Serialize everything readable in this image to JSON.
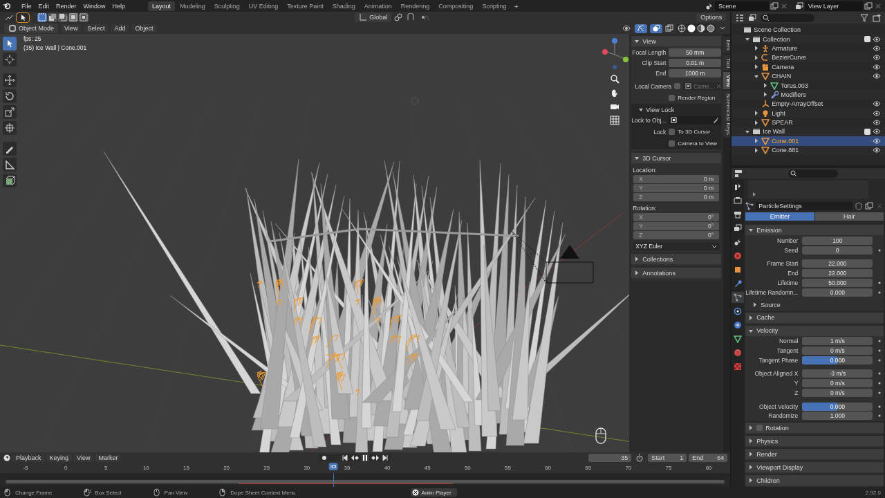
{
  "top_bar": {
    "menus": [
      "File",
      "Edit",
      "Render",
      "Window",
      "Help"
    ],
    "workspaces": [
      {
        "label": "Layout",
        "selected": true
      },
      {
        "label": "Modeling",
        "selected": false
      },
      {
        "label": "Sculpting",
        "selected": false
      },
      {
        "label": "UV Editing",
        "selected": false
      },
      {
        "label": "Texture Paint",
        "selected": false
      },
      {
        "label": "Shading",
        "selected": false
      },
      {
        "label": "Animation",
        "selected": false
      },
      {
        "label": "Rendering",
        "selected": false
      },
      {
        "label": "Compositing",
        "selected": false
      },
      {
        "label": "Scripting",
        "selected": false
      }
    ],
    "add_workspace": "+",
    "scene": "Scene",
    "view_layer": "View Layer"
  },
  "viewport": {
    "orientation": "Global",
    "options": "Options",
    "mode": "Object Mode",
    "menus": [
      "View",
      "Select",
      "Add",
      "Object"
    ],
    "overlay_text": [
      "fps: 25",
      "(35) Ice Wall | Cone.001"
    ],
    "tools": [
      {
        "kind": "select",
        "selected": true
      },
      {
        "kind": "cursor",
        "selected": false
      },
      {
        "kind": "move",
        "selected": false
      },
      {
        "kind": "rotate",
        "selected": false
      },
      {
        "kind": "scale",
        "selected": false
      },
      {
        "kind": "transform",
        "selected": false
      },
      {
        "kind": "annotate",
        "selected": false
      },
      {
        "kind": "measure",
        "selected": false
      },
      {
        "kind": "add",
        "selected": false
      }
    ]
  },
  "sidebar": {
    "tabs": [
      {
        "label": "Item",
        "selected": false
      },
      {
        "label": "Tool",
        "selected": false
      },
      {
        "label": "View",
        "selected": true
      },
      {
        "label": "Screencast Keys",
        "selected": false
      }
    ],
    "sections": [
      {
        "title": "View",
        "expanded": true,
        "rows": [
          {
            "kind": "field",
            "label": "Focal Length",
            "value": "50 mm"
          },
          {
            "kind": "field",
            "label": "Clip Start",
            "value": "0.01 m"
          },
          {
            "kind": "field",
            "label": "End",
            "value": "1000 m"
          },
          {
            "kind": "camera",
            "label": "Local Camera",
            "checked": false,
            "value": "Came..."
          },
          {
            "kind": "check",
            "label": "",
            "text": "Render Region",
            "checked": false
          },
          {
            "kind": "sub",
            "title": "View Lock",
            "expanded": true
          },
          {
            "kind": "object",
            "label": "Lock to Obj..."
          },
          {
            "kind": "check",
            "label": "Lock",
            "text": "To 3D Cursor",
            "checked": false
          },
          {
            "kind": "check",
            "label": "",
            "text": "Camera to View",
            "checked": false
          }
        ]
      },
      {
        "title": "3D Cursor",
        "expanded": true,
        "rows": [
          {
            "kind": "heading",
            "text": "Location:"
          },
          {
            "kind": "vector",
            "items": [
              {
                "axis": "X",
                "value": "0 m"
              },
              {
                "axis": "Y",
                "value": "0 m"
              },
              {
                "axis": "Z",
                "value": "0 m"
              }
            ]
          },
          {
            "kind": "heading",
            "text": "Rotation:"
          },
          {
            "kind": "vector",
            "items": [
              {
                "axis": "X",
                "value": "0°"
              },
              {
                "axis": "Y",
                "value": "0°"
              },
              {
                "axis": "Z",
                "value": "0°"
              }
            ]
          },
          {
            "kind": "dropdown",
            "value": "XYZ Euler"
          }
        ]
      },
      {
        "title": "Collections",
        "expanded": false
      },
      {
        "title": "Annotations",
        "expanded": false
      }
    ]
  },
  "outliner": {
    "tree": [
      {
        "name": "Scene Collection",
        "kind": "scene",
        "children": [
          {
            "name": "Collection",
            "kind": "collection",
            "expanded": true,
            "checked": true,
            "selected": false,
            "children": [
              {
                "name": "Armature",
                "kind": "armature",
                "expanded": false,
                "selected": false
              },
              {
                "name": "BezierCurve",
                "kind": "curve",
                "expanded": false,
                "selected": false
              },
              {
                "name": "Camera",
                "kind": "camera",
                "expanded": false,
                "selected": false
              },
              {
                "name": "CHAIN",
                "kind": "mesh",
                "expanded": true,
                "selected": false,
                "children": [
                  {
                    "name": "Torus.003",
                    "kind": "meshdata",
                    "expanded": false,
                    "selected": false
                  },
                  {
                    "name": "Modifiers",
                    "kind": "modifiers",
                    "expanded": false,
                    "selected": false
                  }
                ]
              },
              {
                "name": "Empty-ArrayOffset",
                "kind": "empty",
                "selected": false
              },
              {
                "name": "Light",
                "kind": "light",
                "expanded": false,
                "selected": false
              },
              {
                "name": "SPEAR",
                "kind": "mesh",
                "expanded": false,
                "selected": false
              }
            ]
          },
          {
            "name": "Ice Wall",
            "kind": "collection",
            "expanded": true,
            "checked": true,
            "selected": false,
            "children": [
              {
                "name": "Cone.001",
                "kind": "mesh",
                "expanded": false,
                "selected": true
              },
              {
                "name": "Cone.881",
                "kind": "mesh",
                "expanded": false,
                "selected": false
              }
            ]
          }
        ]
      }
    ]
  },
  "properties": {
    "tabs": [
      {
        "selected": false
      },
      {
        "selected": false
      },
      {
        "selected": false
      },
      {
        "selected": false
      },
      {
        "selected": false
      },
      {
        "selected": false
      },
      {
        "selected": false
      },
      {
        "selected": false
      },
      {
        "selected": true
      },
      {
        "selected": false
      },
      {
        "selected": false
      },
      {
        "selected": false
      },
      {
        "selected": false
      },
      {
        "selected": false
      }
    ],
    "settings_name": "ParticleSettings",
    "types": [
      {
        "label": "Emitter",
        "selected": true
      },
      {
        "label": "Hair",
        "selected": false
      }
    ],
    "sections": [
      {
        "title": "Emission",
        "expanded": true,
        "rows": [
          {
            "kind": "field",
            "label": "Number",
            "value": "100",
            "keyframe": false
          },
          {
            "kind": "field",
            "label": "Seed",
            "value": "0",
            "keyframe": true
          },
          {
            "kind": "gap"
          },
          {
            "kind": "field",
            "label": "Frame Start",
            "value": "22.000",
            "keyframe": false
          },
          {
            "kind": "field",
            "label": "End",
            "value": "22.000",
            "keyframe": false
          },
          {
            "kind": "field",
            "label": "Lifetime",
            "value": "50.000",
            "keyframe": true
          },
          {
            "kind": "field",
            "label": "Lifetime Randomn...",
            "value": "0.000",
            "keyframe": true
          },
          {
            "kind": "sub",
            "title": "Source",
            "expanded": false
          }
        ]
      },
      {
        "title": "Cache",
        "expanded": false
      },
      {
        "title": "Velocity",
        "expanded": true,
        "rows": [
          {
            "kind": "field",
            "label": "Normal",
            "value": "1 m/s",
            "keyframe": true
          },
          {
            "kind": "field",
            "label": "Tangent",
            "value": "0 m/s",
            "keyframe": true
          },
          {
            "kind": "slider",
            "label": "Tangent Phase",
            "value": "0.000",
            "level": 0.5,
            "keyframe": true
          },
          {
            "kind": "gap"
          },
          {
            "kind": "field",
            "label": "Object Aligned X",
            "value": "-3 m/s",
            "keyframe": true
          },
          {
            "kind": "field",
            "label": "Y",
            "value": "0 m/s",
            "keyframe": true
          },
          {
            "kind": "field",
            "label": "Z",
            "value": "0 m/s",
            "keyframe": true
          },
          {
            "kind": "gap"
          },
          {
            "kind": "slider",
            "label": "Object Velocity",
            "value": "0.000",
            "level": 0.5,
            "keyframe": true
          },
          {
            "kind": "field",
            "label": "Randomize",
            "value": "1.000",
            "keyframe": true
          }
        ]
      },
      {
        "title": "Rotation",
        "expanded": false,
        "checked": false
      },
      {
        "title": "Physics",
        "expanded": false
      },
      {
        "title": "Render",
        "expanded": false
      },
      {
        "title": "Viewport Display",
        "expanded": false
      },
      {
        "title": "Children",
        "expanded": false
      }
    ]
  },
  "timeline": {
    "menus": [
      "Playback",
      "Keying",
      "View",
      "Marker"
    ],
    "current_frame": "35",
    "start_label": "Start",
    "start": "1",
    "end_label": "End",
    "end": "64",
    "ticks": [
      "-5",
      "0",
      "5",
      "10",
      "15",
      "20",
      "25",
      "30",
      "35",
      "40",
      "45",
      "50",
      "55",
      "60",
      "65",
      "70",
      "75",
      "80"
    ],
    "playhead": {
      "label": "35",
      "level": 0.444
    }
  },
  "status_bar": {
    "hints": [
      {
        "kind": "left-mouse",
        "text": "Change Frame"
      },
      {
        "kind": "drag-mouse",
        "text": "Box Select"
      },
      {
        "kind": "middle-mouse",
        "text": "Pan View"
      },
      {
        "kind": "right-mouse",
        "text": "Dope Sheet Context Menu"
      }
    ],
    "running_job": "Anim Player",
    "version": "2.92.0"
  }
}
